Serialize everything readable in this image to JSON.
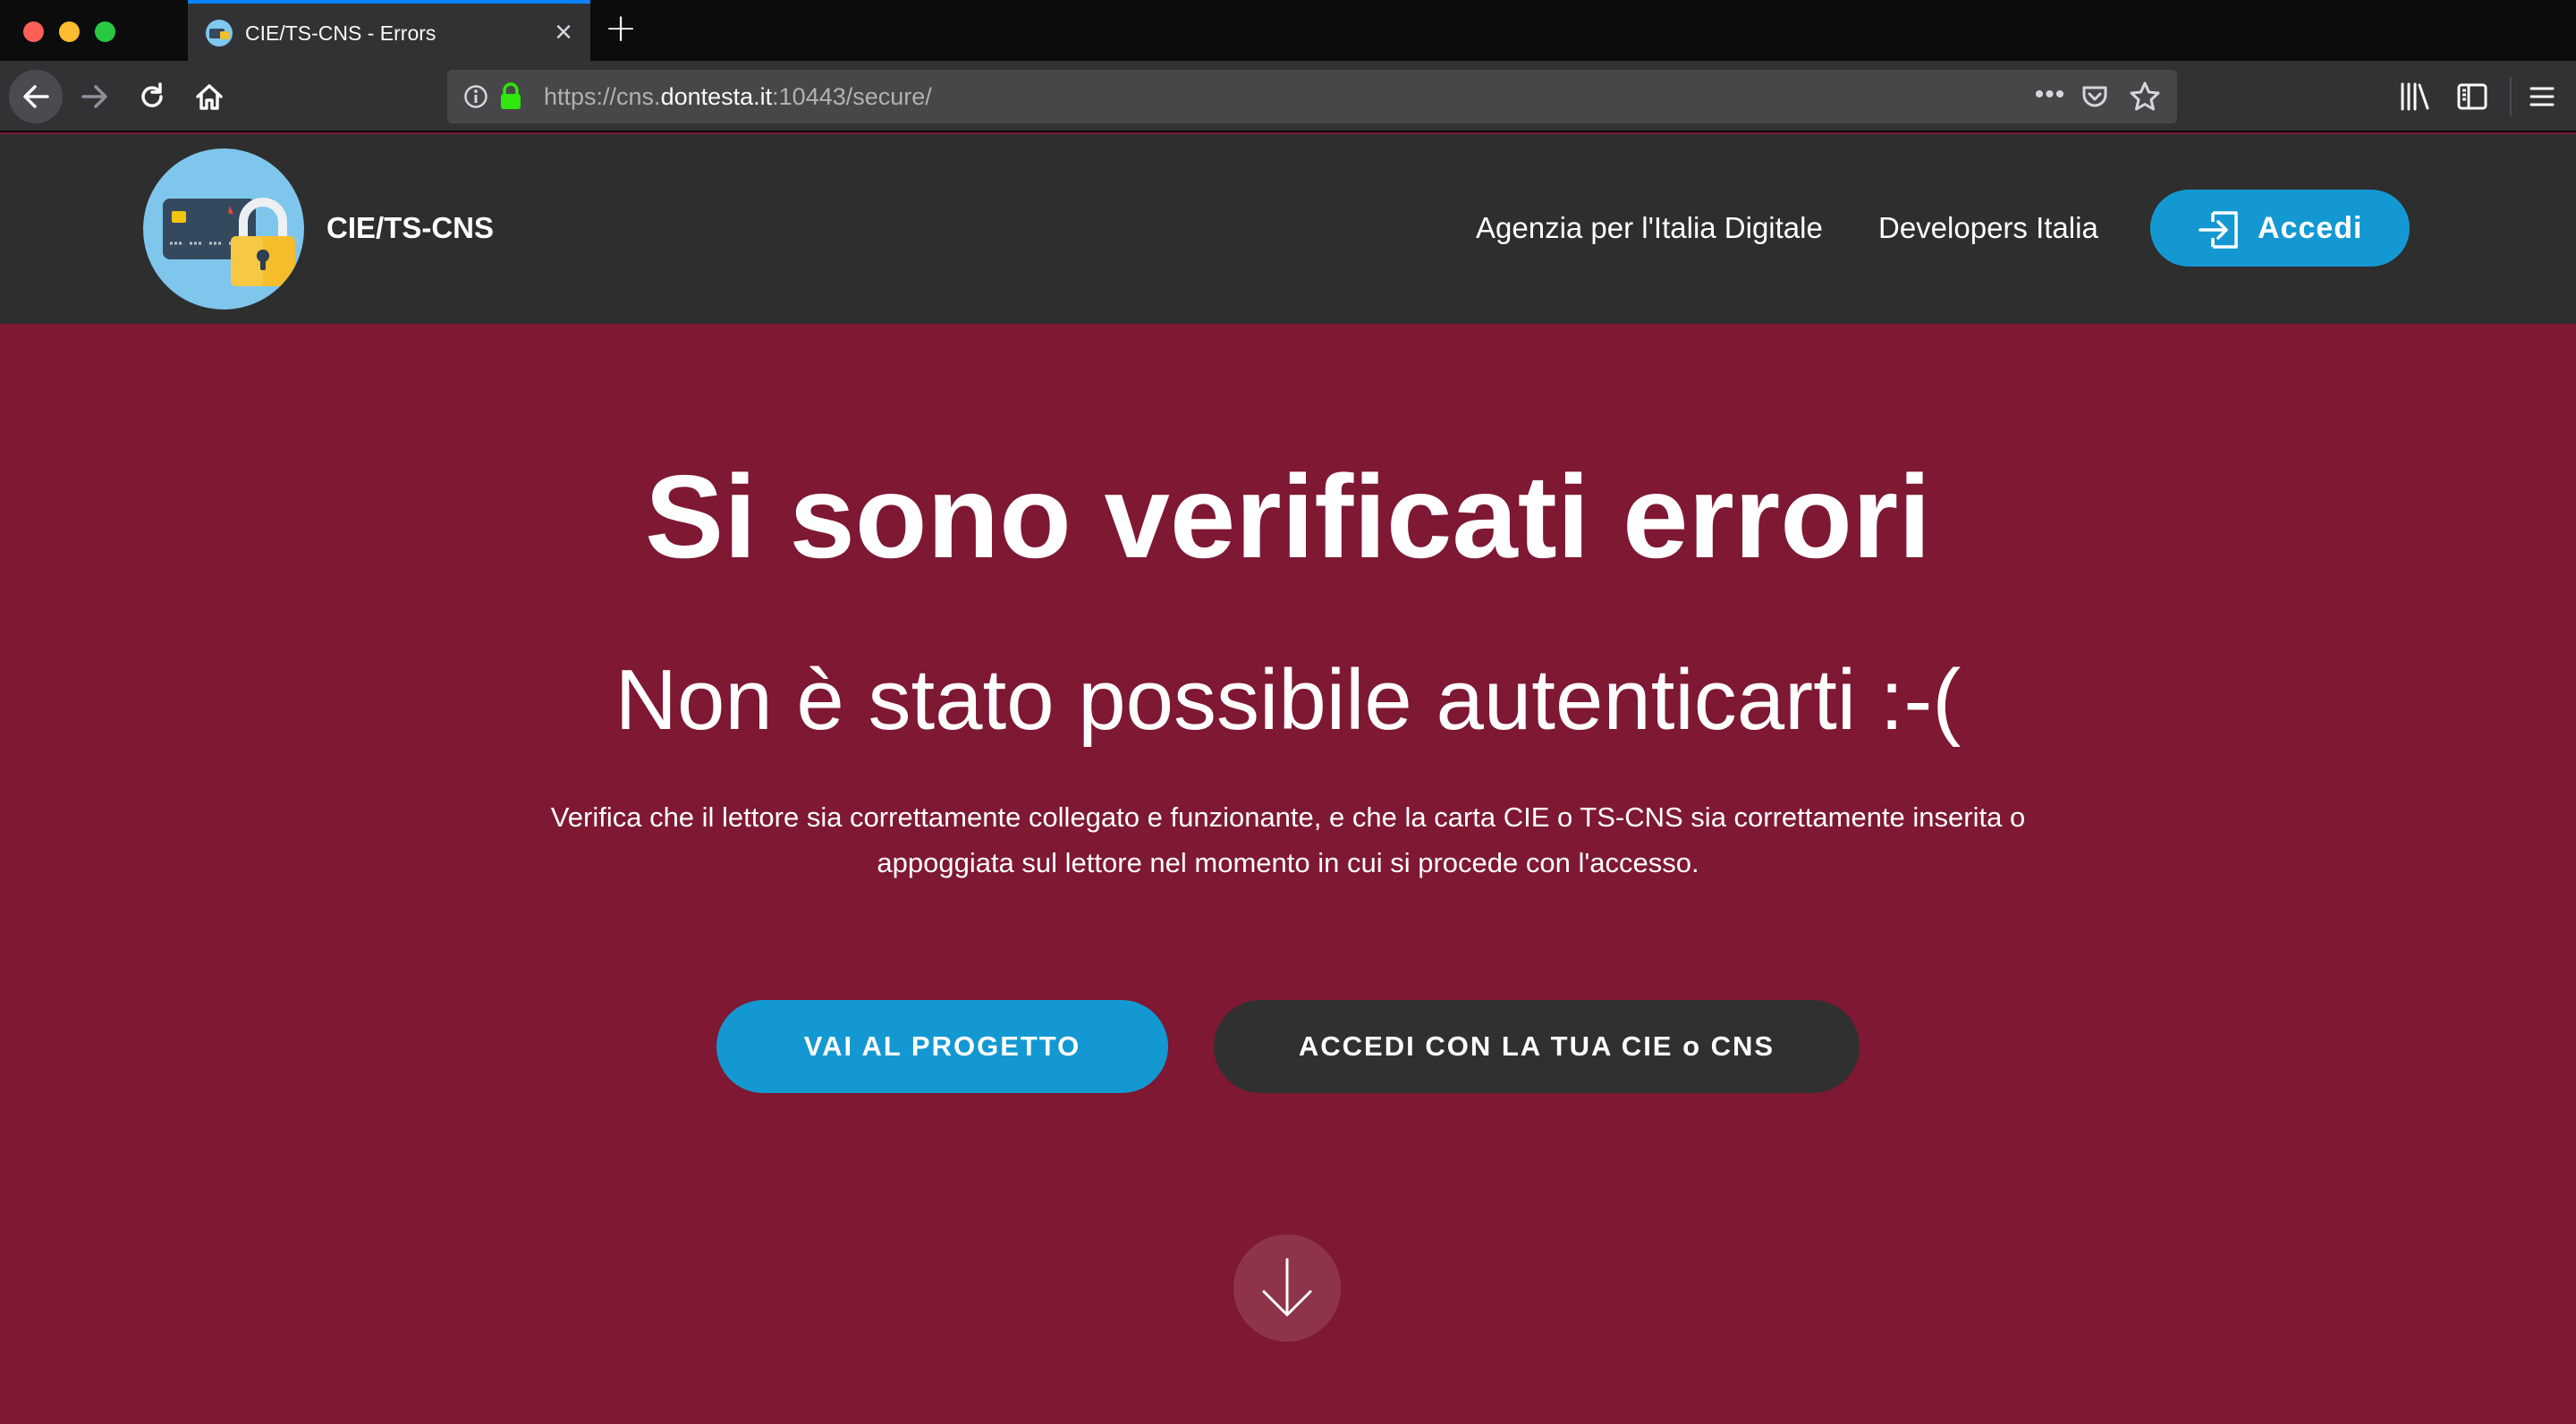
{
  "browser": {
    "tab_title": "CIE/TS-CNS - Errors",
    "tab_close": "×",
    "new_tab": "+",
    "url_prefix": "https://cns.",
    "url_domain": "dontesta.it",
    "url_suffix": ":10443/secure/",
    "url_more": "•••"
  },
  "header": {
    "site_name": "CIE/TS-CNS",
    "links": [
      "Agenzia per l'Italia Digitale",
      "Developers Italia"
    ],
    "login_label": "Accedi"
  },
  "hero": {
    "title": "Si sono verificati errori",
    "subtitle": "Non è stato possibile autenticarti :-(",
    "description": "Verifica che il lettore sia correttamente collegato e funzionante, e che la carta CIE o TS-CNS sia correttamente inserita o appoggiata sul lettore nel momento in cui si procede con l'accesso.",
    "primary_button": "VAI AL PROGETTO",
    "secondary_button": "ACCEDI CON LA TUA CIE o CNS"
  },
  "colors": {
    "hero_background": "#7e1833",
    "header_background": "#2e2e2f",
    "accent_blue": "#1498d2",
    "dark_button": "#303030"
  },
  "icons": [
    "back-arrow-icon",
    "forward-arrow-icon",
    "reload-icon",
    "home-icon",
    "info-icon",
    "padlock-icon",
    "pocket-icon",
    "bookmark-star-icon",
    "library-icon",
    "sidebar-icon",
    "hamburger-menu-icon",
    "login-icon",
    "arrow-down-icon"
  ]
}
